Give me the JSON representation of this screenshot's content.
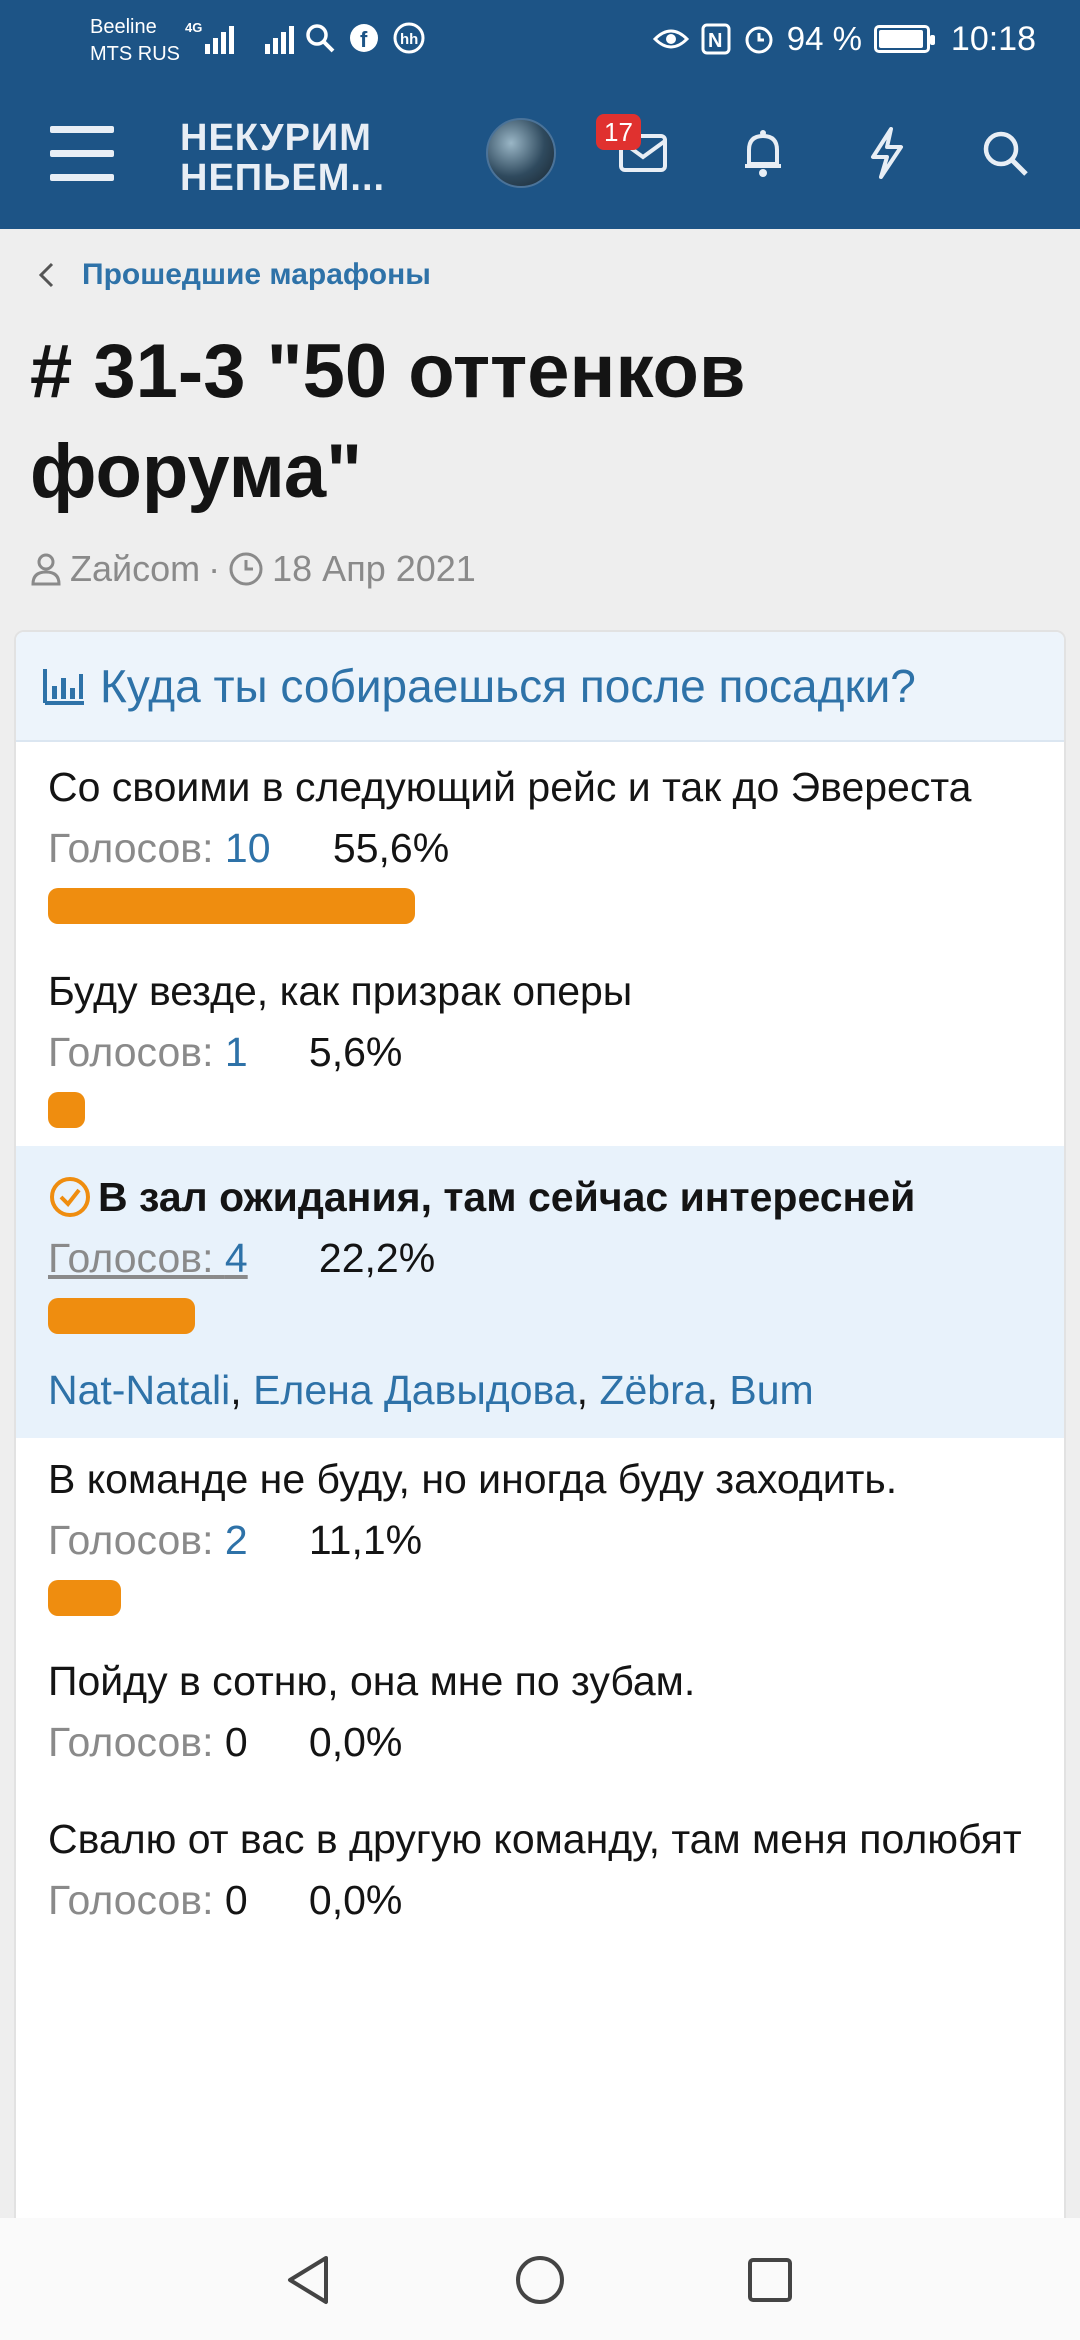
{
  "status_bar": {
    "carrier_line1": "Beeline",
    "carrier_line2": "MTS RUS",
    "network": "4G",
    "battery": "94 %",
    "time": "10:18"
  },
  "header": {
    "logo_line1": "НЕКУРИМ",
    "logo_line2": "НЕПЬЕМ...",
    "inbox_badge": "17",
    "icons": [
      "menu-icon",
      "avatar",
      "inbox-icon",
      "bell-icon",
      "lightning-icon",
      "search-icon"
    ]
  },
  "breadcrumb": {
    "label": "Прошедшие марафоны"
  },
  "thread": {
    "title": "# 31-3 \"50 оттенков форума\"",
    "author": "Zайсom",
    "date": "18 Апр 2021"
  },
  "poll": {
    "question": "Куда ты собираешься после посадки?",
    "votes_label": "Голосов:",
    "options": [
      {
        "text": "Со своими в следующий рейс и так до Эвереста",
        "votes": "10",
        "percent": "55,6%",
        "fraction": 0.556
      },
      {
        "text": "Буду везде, как призрак оперы",
        "votes": "1",
        "percent": "5,6%",
        "fraction": 0.056
      },
      {
        "text": "В зал ожидания, там сейчас интересней",
        "votes": "4",
        "percent": "22,2%",
        "fraction": 0.222,
        "selected": true,
        "voters": [
          "Nat-Natali",
          "Елена Давыдова",
          "Zёbra",
          "Bum"
        ]
      },
      {
        "text": "В команде не буду, но иногда буду заходить.",
        "votes": "2",
        "percent": "11,1%",
        "fraction": 0.111
      },
      {
        "text": "Пойду в сотню, она мне по зубам.",
        "votes": "0",
        "percent": "0,0%",
        "fraction": 0
      },
      {
        "text": "Свалю от вас в другую команду, там меня полюбят",
        "votes": "0",
        "percent": "0,0%",
        "fraction": 0
      }
    ]
  },
  "colors": {
    "header": "#1d5486",
    "accent": "#2e72a8",
    "bar": "#ef8d0f",
    "badge": "#e0312f"
  }
}
